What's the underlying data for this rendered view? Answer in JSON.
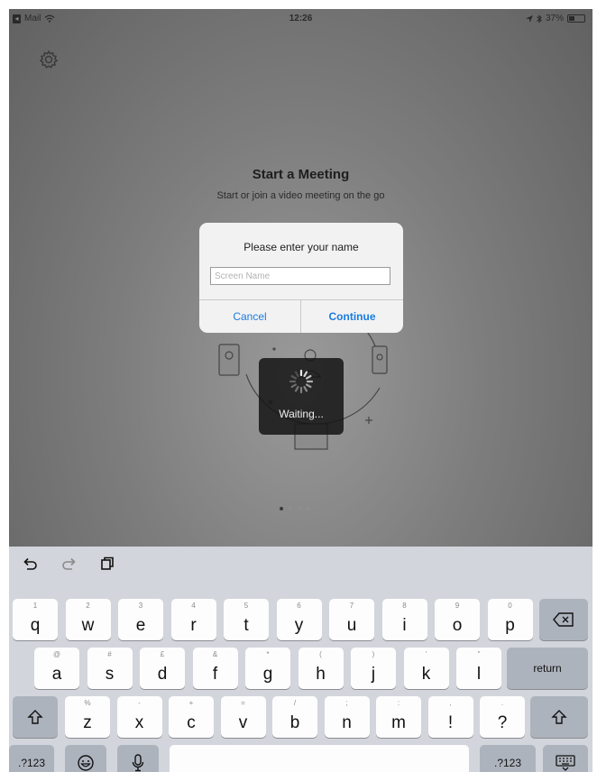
{
  "status_bar": {
    "back_app": "Mail",
    "time": "12:26",
    "battery": "37%"
  },
  "main": {
    "title": "Start a Meeting",
    "subtitle": "Start or join a video meeting on the go",
    "waiting_text": "Waiting...",
    "page_count": 4,
    "active_page": 0
  },
  "dialog": {
    "title": "Please enter your name",
    "input_placeholder": "Screen Name",
    "input_value": "",
    "cancel_label": "Cancel",
    "continue_label": "Continue"
  },
  "colors": {
    "accent": "#1a7ce0",
    "keyboard_bg": "#d2d5db",
    "dark_key": "#adb3bd"
  },
  "keyboard": {
    "row1": [
      {
        "main": "q",
        "sub": "1"
      },
      {
        "main": "w",
        "sub": "2"
      },
      {
        "main": "e",
        "sub": "3"
      },
      {
        "main": "r",
        "sub": "4"
      },
      {
        "main": "t",
        "sub": "5"
      },
      {
        "main": "y",
        "sub": "6"
      },
      {
        "main": "u",
        "sub": "7"
      },
      {
        "main": "i",
        "sub": "8"
      },
      {
        "main": "o",
        "sub": "9"
      },
      {
        "main": "p",
        "sub": "0"
      }
    ],
    "row2": [
      {
        "main": "a",
        "sub": "@"
      },
      {
        "main": "s",
        "sub": "#"
      },
      {
        "main": "d",
        "sub": "£"
      },
      {
        "main": "f",
        "sub": "&"
      },
      {
        "main": "g",
        "sub": "*"
      },
      {
        "main": "h",
        "sub": "("
      },
      {
        "main": "j",
        "sub": ")"
      },
      {
        "main": "k",
        "sub": "'"
      },
      {
        "main": "l",
        "sub": "\""
      }
    ],
    "row3": [
      {
        "main": "z",
        "sub": "%"
      },
      {
        "main": "x",
        "sub": "-"
      },
      {
        "main": "c",
        "sub": "+"
      },
      {
        "main": "v",
        "sub": "="
      },
      {
        "main": "b",
        "sub": "/"
      },
      {
        "main": "n",
        "sub": ";"
      },
      {
        "main": "m",
        "sub": ":"
      },
      {
        "main": "!",
        "sub": ","
      },
      {
        "main": "?",
        "sub": "."
      }
    ],
    "return_label": "return",
    "numbers_label": ".?123"
  },
  "icons": {
    "settings": "gear-icon",
    "undo": "undo-icon",
    "redo": "redo-icon",
    "paste": "clipboard-icon",
    "delete": "backspace-icon",
    "shift": "shift-icon",
    "emoji": "emoji-icon",
    "dictation": "microphone-icon",
    "hide_keyboard": "keyboard-hide-icon"
  }
}
